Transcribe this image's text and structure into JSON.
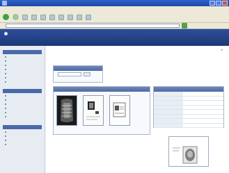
{
  "browser": {
    "title": "",
    "menu": [
      "",
      "",
      "",
      "",
      "",
      ""
    ],
    "address_label": "",
    "address_value": ""
  },
  "portal": {
    "logo_text": "",
    "header_title": ""
  },
  "sidebar": {
    "sections": [
      {
        "title": "",
        "items": [
          "",
          "",
          "",
          "",
          "",
          "",
          ""
        ]
      },
      {
        "title": "",
        "items": [
          "",
          "",
          "",
          "",
          "",
          ""
        ]
      },
      {
        "title": "",
        "items": [
          "",
          "",
          "",
          ""
        ]
      }
    ]
  },
  "main": {
    "breadcrumb": "",
    "page_title": "",
    "page_subtitle": "",
    "search_panel": {
      "title": "",
      "field_label": "",
      "button_label": ""
    },
    "images_panel": {
      "title": "",
      "items": [
        {
          "label": ""
        },
        {
          "label": ""
        },
        {
          "label": ""
        }
      ]
    },
    "metadata_panel": {
      "title": "",
      "rows": [
        {
          "key": "",
          "value": ""
        },
        {
          "key": "",
          "value": ""
        },
        {
          "key": "",
          "value": ""
        },
        {
          "key": "",
          "value": ""
        },
        {
          "key": "",
          "value": ""
        },
        {
          "key": "",
          "value": ""
        },
        {
          "key": "",
          "value": ""
        },
        {
          "key": "",
          "value": ""
        }
      ]
    },
    "preview": {
      "title": ""
    }
  }
}
